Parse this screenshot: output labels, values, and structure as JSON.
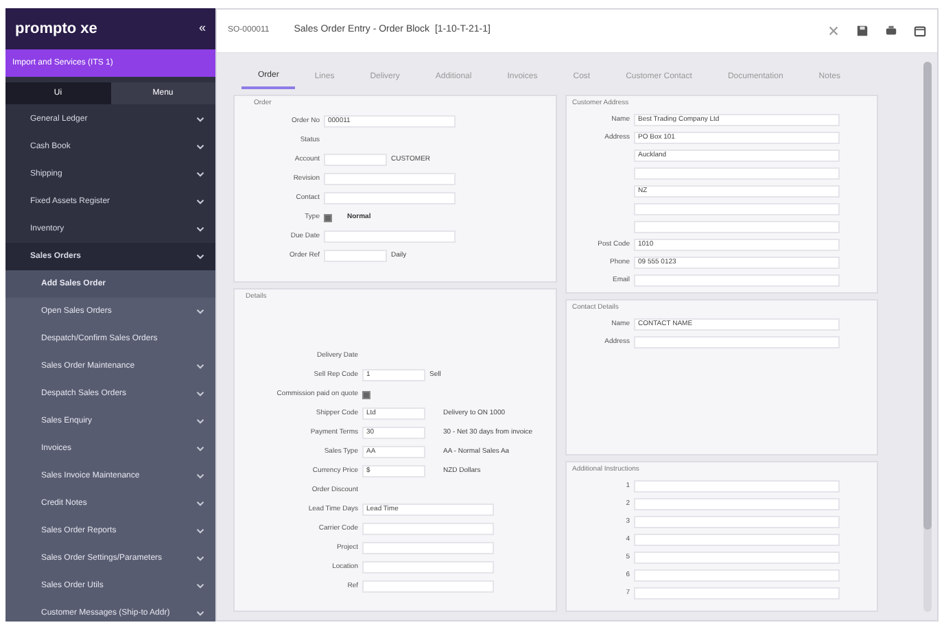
{
  "brand": {
    "name": "prompto xe",
    "collapse": "«"
  },
  "company": "Import and Services (ITS 1)",
  "sidebar_tabs": [
    {
      "label": "Ui",
      "selected": true
    },
    {
      "label": "Menu",
      "selected": false
    }
  ],
  "menu": [
    {
      "label": "General Ledger",
      "expanded": false
    },
    {
      "label": "Cash Book",
      "expanded": false
    },
    {
      "label": "Shipping",
      "expanded": false
    },
    {
      "label": "Fixed Assets Register",
      "expanded": false
    },
    {
      "label": "Inventory",
      "expanded": false
    },
    {
      "label": "Sales Orders",
      "expanded": true,
      "children": [
        {
          "label": "Add Sales Order",
          "selected": true,
          "has_children": false
        },
        {
          "label": "Open Sales Orders",
          "selected": false,
          "has_children": true
        },
        {
          "label": "Despatch/Confirm Sales Orders",
          "selected": false,
          "has_children": false
        },
        {
          "label": "Sales Order Maintenance",
          "selected": false,
          "has_children": true
        },
        {
          "label": "Despatch Sales Orders",
          "selected": false,
          "has_children": true
        },
        {
          "label": "Sales Enquiry",
          "selected": false,
          "has_children": true
        },
        {
          "label": "Invoices",
          "selected": false,
          "has_children": true
        },
        {
          "label": "Sales Invoice Maintenance",
          "selected": false,
          "has_children": true
        },
        {
          "label": "Credit Notes",
          "selected": false,
          "has_children": true
        },
        {
          "label": "Sales Order Reports",
          "selected": false,
          "has_children": true
        },
        {
          "label": "Sales Order Settings/Parameters",
          "selected": false,
          "has_children": true
        },
        {
          "label": "Sales Order Utils",
          "selected": false,
          "has_children": true
        },
        {
          "label": "Customer Messages (Ship-to Addr)",
          "selected": false,
          "has_children": true
        }
      ]
    }
  ],
  "header": {
    "record": "SO-000011",
    "title": "Sales Order Entry - Order Block  [1-10-T-21-1]"
  },
  "tabs": [
    {
      "label": "Order",
      "selected": true
    },
    {
      "label": "Lines",
      "selected": false
    },
    {
      "label": "Delivery",
      "selected": false
    },
    {
      "label": "Additional",
      "selected": false
    },
    {
      "label": "Invoices",
      "selected": false
    },
    {
      "label": "Cost",
      "selected": false
    },
    {
      "label": "Customer Contact",
      "selected": false
    },
    {
      "label": "Documentation",
      "selected": false
    },
    {
      "label": "Notes",
      "selected": false
    }
  ],
  "order_panel": {
    "title": "Order",
    "rows": [
      {
        "kind": "field",
        "label": "Order No",
        "value": "000011"
      },
      {
        "kind": "text",
        "label": "Status"
      },
      {
        "kind": "pair",
        "label": "Account",
        "value": "CUSTOMER"
      },
      {
        "kind": "field",
        "label": "Revision"
      },
      {
        "kind": "field",
        "label": "Contact"
      },
      {
        "kind": "check",
        "label": "Type",
        "checked": true,
        "value": "Normal"
      },
      {
        "kind": "field",
        "label": "Due Date"
      },
      {
        "kind": "pair",
        "label": "Order Ref",
        "value": "Daily"
      }
    ]
  },
  "details_panel": {
    "title": "Details",
    "rows": [
      {
        "kind": "text",
        "label": "Delivery Date"
      },
      {
        "kind": "pair",
        "label": "Sell Rep Code",
        "value": "Sell",
        "code": "1"
      },
      {
        "kind": "check",
        "label": "Commission paid on quote",
        "checked": true
      },
      {
        "kind": "note",
        "label": "Shipper Code",
        "code": "Ltd",
        "value": "Delivery to ON 1000"
      },
      {
        "kind": "note",
        "label": "Payment Terms",
        "code": "30",
        "value": "30 - Net 30 days from invoice"
      },
      {
        "kind": "note",
        "label": "Sales Type",
        "code": "AA",
        "value": "AA - Normal Sales Aa"
      },
      {
        "kind": "note",
        "label": "Currency Price",
        "code": "$",
        "value": "NZD Dollars"
      },
      {
        "kind": "text",
        "label": "Order Discount"
      },
      {
        "kind": "drop",
        "label": "Lead Time Days",
        "value": "Lead Time"
      },
      {
        "kind": "field",
        "label": "Carrier Code"
      },
      {
        "kind": "field",
        "label": "Project"
      },
      {
        "kind": "field",
        "label": "Location"
      },
      {
        "kind": "field",
        "label": "Ref"
      }
    ]
  },
  "address_panel": {
    "title": "Customer Address",
    "rows": [
      {
        "label": "Name",
        "value": "Best Trading Company Ltd"
      },
      {
        "label": "Address",
        "value": "PO Box 101"
      },
      {
        "value": "Auckland"
      },
      {},
      {
        "value": "NZ"
      },
      {},
      {},
      {
        "label": "Post Code",
        "value": "1010"
      },
      {
        "label": "Phone",
        "value": "09 555 0123"
      },
      {
        "label": "Email"
      }
    ]
  },
  "contact_panel": {
    "title": "Contact Details",
    "rows": [
      {
        "label": "Name",
        "value": "CONTACT NAME"
      },
      {
        "label": "Address"
      }
    ]
  },
  "instructions_panel": {
    "title": "Additional Instructions",
    "rows": [
      {
        "label": "1"
      },
      {
        "label": "2"
      },
      {
        "label": "3"
      },
      {
        "label": "4"
      },
      {
        "label": "5"
      },
      {
        "label": "6"
      },
      {
        "label": "7"
      }
    ]
  }
}
